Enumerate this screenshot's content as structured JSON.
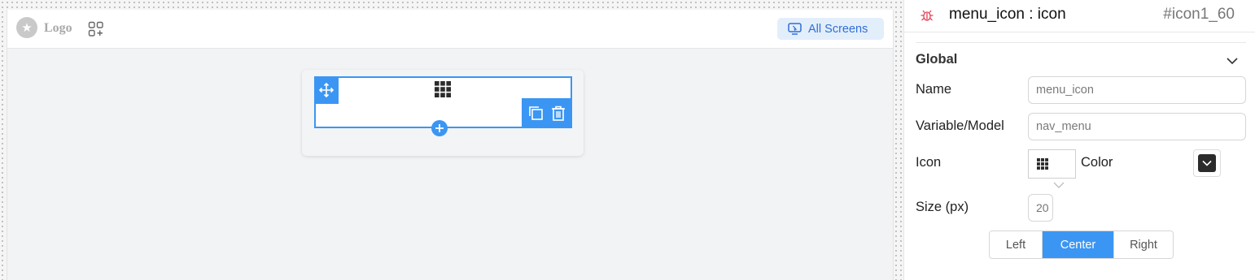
{
  "topbar": {
    "logo_text": "Logo",
    "all_screens_label": "All Screens"
  },
  "panel": {
    "title": "menu_icon : icon",
    "id": "#icon1_60",
    "section_title": "Global",
    "name_label": "Name",
    "name_value": "menu_icon",
    "variable_label": "Variable/Model",
    "variable_value": "nav_menu",
    "icon_label": "Icon",
    "color_label": "Color",
    "color_value": "#2b2b2b",
    "size_label": "Size (px)",
    "size_value": "20",
    "align_left": "Left",
    "align_center": "Center",
    "align_right": "Right",
    "selected_alignment": "Center"
  },
  "colors": {
    "accent": "#3b96f3",
    "all_screens_bg": "#e3eefb",
    "all_screens_text": "#2f6fd6"
  },
  "icons": {
    "logo": "star-icon",
    "add_widget": "add-widget-icon",
    "all_screens": "screen-cursor-icon",
    "move": "move-icon",
    "menu_grid": "grid-icon",
    "copy": "copy-icon",
    "delete": "trash-icon",
    "add": "plus-icon",
    "component_type": "bug-icon",
    "collapse": "chevron-down-icon"
  }
}
